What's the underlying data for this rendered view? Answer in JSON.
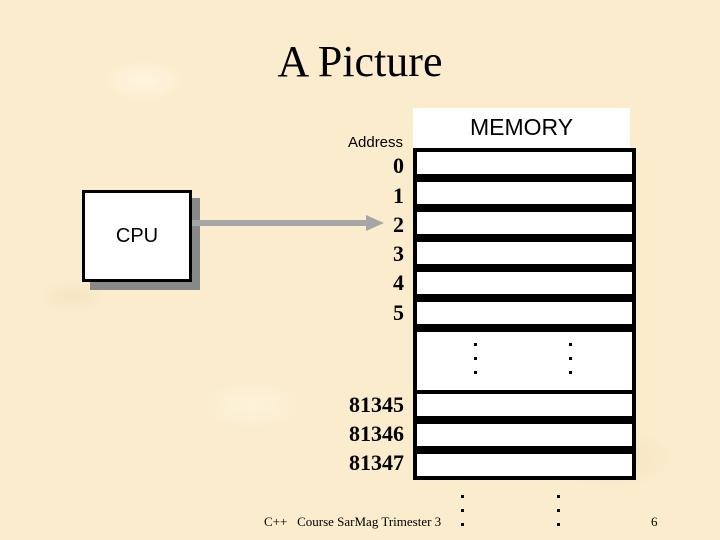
{
  "slide": {
    "title": "A Picture",
    "footer": "C++   Course SarMag Trimester 3",
    "page_number": "6"
  },
  "diagram": {
    "cpu_label": "CPU",
    "memory_label": "MEMORY",
    "address_label": "Address",
    "arrow_points_to_address": "2",
    "addresses_top": [
      "0",
      "1",
      "2",
      "3",
      "4",
      "5"
    ],
    "addresses_bottom": [
      "81345",
      "81346",
      "81347"
    ],
    "ellipsis": "..."
  },
  "colors": {
    "background": "#fbeccd",
    "arrow": "#a6a6a6",
    "cpu_shadow": "#888888",
    "cell_fill": "#ffffff",
    "cell_border": "#000000"
  }
}
